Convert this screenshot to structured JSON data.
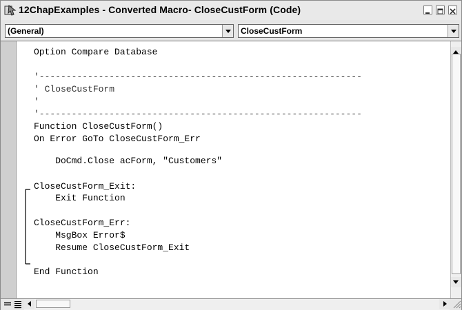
{
  "window": {
    "title": "12ChapExamples - Converted Macro- CloseCustForm (Code)",
    "title_icon": "vba-code-window-icon",
    "controls": [
      "minimize-icon",
      "restore-icon",
      "close-icon"
    ]
  },
  "object_combo": {
    "value": "(General)"
  },
  "procedure_combo": {
    "value": "CloseCustForm"
  },
  "code_lines": [
    "Option Compare Database",
    "",
    "'------------------------------------------------------------",
    "' CloseCustForm",
    "'",
    "'------------------------------------------------------------",
    "Function CloseCustForm()",
    "On Error GoTo CloseCustForm_Err",
    "",
    "    DoCmd.Close acForm, \"Customers\"",
    "",
    "CloseCustForm_Exit:",
    "    Exit Function",
    "",
    "CloseCustForm_Err:",
    "    MsgBox Error$",
    "    Resume CloseCustForm_Exit",
    "",
    "End Function"
  ],
  "colors": {
    "window_bg": "#e6e6e6",
    "editor_bg": "#ffffff",
    "text": "#000000"
  }
}
